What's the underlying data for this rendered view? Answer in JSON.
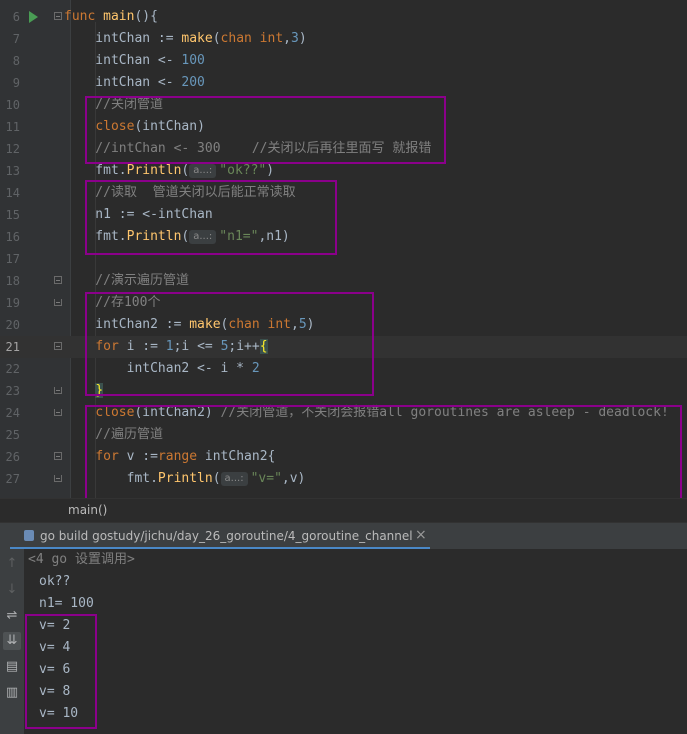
{
  "editor": {
    "lines": [
      {
        "n": "6",
        "segs": [
          {
            "t": "func ",
            "c": "kw"
          },
          {
            "t": "main",
            "c": "fn"
          },
          {
            "t": "(){"
          }
        ]
      },
      {
        "n": "7",
        "segs": [
          {
            "t": "    intChan := "
          },
          {
            "t": "make",
            "c": "fn"
          },
          {
            "t": "("
          },
          {
            "t": "chan int",
            "c": "kw"
          },
          {
            "t": ","
          },
          {
            "t": "3",
            "c": "num"
          },
          {
            "t": ")"
          }
        ]
      },
      {
        "n": "8",
        "segs": [
          {
            "t": "    intChan <- "
          },
          {
            "t": "100",
            "c": "num"
          }
        ]
      },
      {
        "n": "9",
        "segs": [
          {
            "t": "    intChan <- "
          },
          {
            "t": "200",
            "c": "num"
          }
        ]
      },
      {
        "n": "10",
        "segs": [
          {
            "t": "    //关闭管道",
            "c": "cm"
          }
        ]
      },
      {
        "n": "11",
        "segs": [
          {
            "t": "    "
          },
          {
            "t": "close",
            "c": "kw"
          },
          {
            "t": "(intChan)"
          }
        ]
      },
      {
        "n": "12",
        "segs": [
          {
            "t": "    //intChan <- 300    //关闭以后再往里面写 就报错",
            "c": "cm"
          }
        ]
      },
      {
        "n": "13",
        "segs": [
          {
            "t": "    fmt."
          },
          {
            "t": "Println",
            "c": "fn"
          },
          {
            "t": "("
          },
          {
            "t": "a...:",
            "c": "hint"
          },
          {
            "t": "\"ok??\"",
            "c": "str"
          },
          {
            "t": ")"
          }
        ]
      },
      {
        "n": "14",
        "segs": [
          {
            "t": "    //读取  管道关闭以后能正常读取",
            "c": "cm"
          }
        ]
      },
      {
        "n": "15",
        "segs": [
          {
            "t": "    n1 := <-intChan"
          }
        ]
      },
      {
        "n": "16",
        "segs": [
          {
            "t": "    fmt."
          },
          {
            "t": "Println",
            "c": "fn"
          },
          {
            "t": "("
          },
          {
            "t": "a...:",
            "c": "hint"
          },
          {
            "t": "\"n1=\"",
            "c": "str"
          },
          {
            "t": ",n1)"
          }
        ]
      },
      {
        "n": "17",
        "segs": []
      },
      {
        "n": "18",
        "segs": [
          {
            "t": "    //演示遍历管道",
            "c": "cm"
          }
        ]
      },
      {
        "n": "19",
        "segs": [
          {
            "t": "    //存100个",
            "c": "cm"
          }
        ]
      },
      {
        "n": "20",
        "segs": [
          {
            "t": "    intChan2 := "
          },
          {
            "t": "make",
            "c": "fn"
          },
          {
            "t": "("
          },
          {
            "t": "chan int",
            "c": "kw"
          },
          {
            "t": ","
          },
          {
            "t": "5",
            "c": "num"
          },
          {
            "t": ")"
          }
        ]
      },
      {
        "n": "21",
        "segs": [
          {
            "t": "    "
          },
          {
            "t": "for",
            "c": "kw"
          },
          {
            "t": " i := "
          },
          {
            "t": "1",
            "c": "num"
          },
          {
            "t": ";i <= "
          },
          {
            "t": "5",
            "c": "num"
          },
          {
            "t": ";i++"
          },
          {
            "t": "{",
            "c": "brace-hl"
          }
        ],
        "current": true
      },
      {
        "n": "22",
        "segs": [
          {
            "t": "        intChan2 <- i * "
          },
          {
            "t": "2",
            "c": "num"
          }
        ]
      },
      {
        "n": "23",
        "segs": [
          {
            "t": "    "
          },
          {
            "t": "}",
            "c": "brace-hl"
          }
        ]
      },
      {
        "n": "24",
        "segs": [
          {
            "t": "    "
          },
          {
            "t": "close",
            "c": "kw"
          },
          {
            "t": "(intChan2) "
          },
          {
            "t": "//关闭管道，不关闭会报错all goroutines are asleep - deadlock!",
            "c": "cm"
          }
        ]
      },
      {
        "n": "25",
        "segs": [
          {
            "t": "    //遍历管道",
            "c": "cm"
          }
        ]
      },
      {
        "n": "26",
        "segs": [
          {
            "t": "    "
          },
          {
            "t": "for",
            "c": "kw"
          },
          {
            "t": " v :="
          },
          {
            "t": "range",
            "c": "kw"
          },
          {
            "t": " intChan2{"
          }
        ]
      },
      {
        "n": "27",
        "segs": [
          {
            "t": "        fmt."
          },
          {
            "t": "Println",
            "c": "fn"
          },
          {
            "t": "("
          },
          {
            "t": "a...:",
            "c": "hint"
          },
          {
            "t": "\"v=\"",
            "c": "str"
          },
          {
            "t": ",v)"
          }
        ]
      }
    ]
  },
  "breadcrumb": {
    "label": "main()"
  },
  "run_panel": {
    "tab_label": "go build gostudy/jichu/day_26_goroutine/4_goroutine_channel",
    "close_glyph": "×",
    "output": [
      "<4 go 设置调用>",
      "ok??",
      "n1= 100",
      "v= 2",
      "v= 4",
      "v= 6",
      "v= 8",
      "v= 10"
    ]
  },
  "icons": {
    "run_gutter": "run-icon",
    "toolbar": [
      "up-arrow-icon",
      "down-arrow-icon",
      "soft-wrap-icon",
      "scroll-to-end-icon",
      "print-icon",
      "trash-icon"
    ]
  },
  "colors": {
    "highlight_box": "#8b008b",
    "tab_underline": "#4a88c7",
    "run_icon": "#499c54"
  }
}
